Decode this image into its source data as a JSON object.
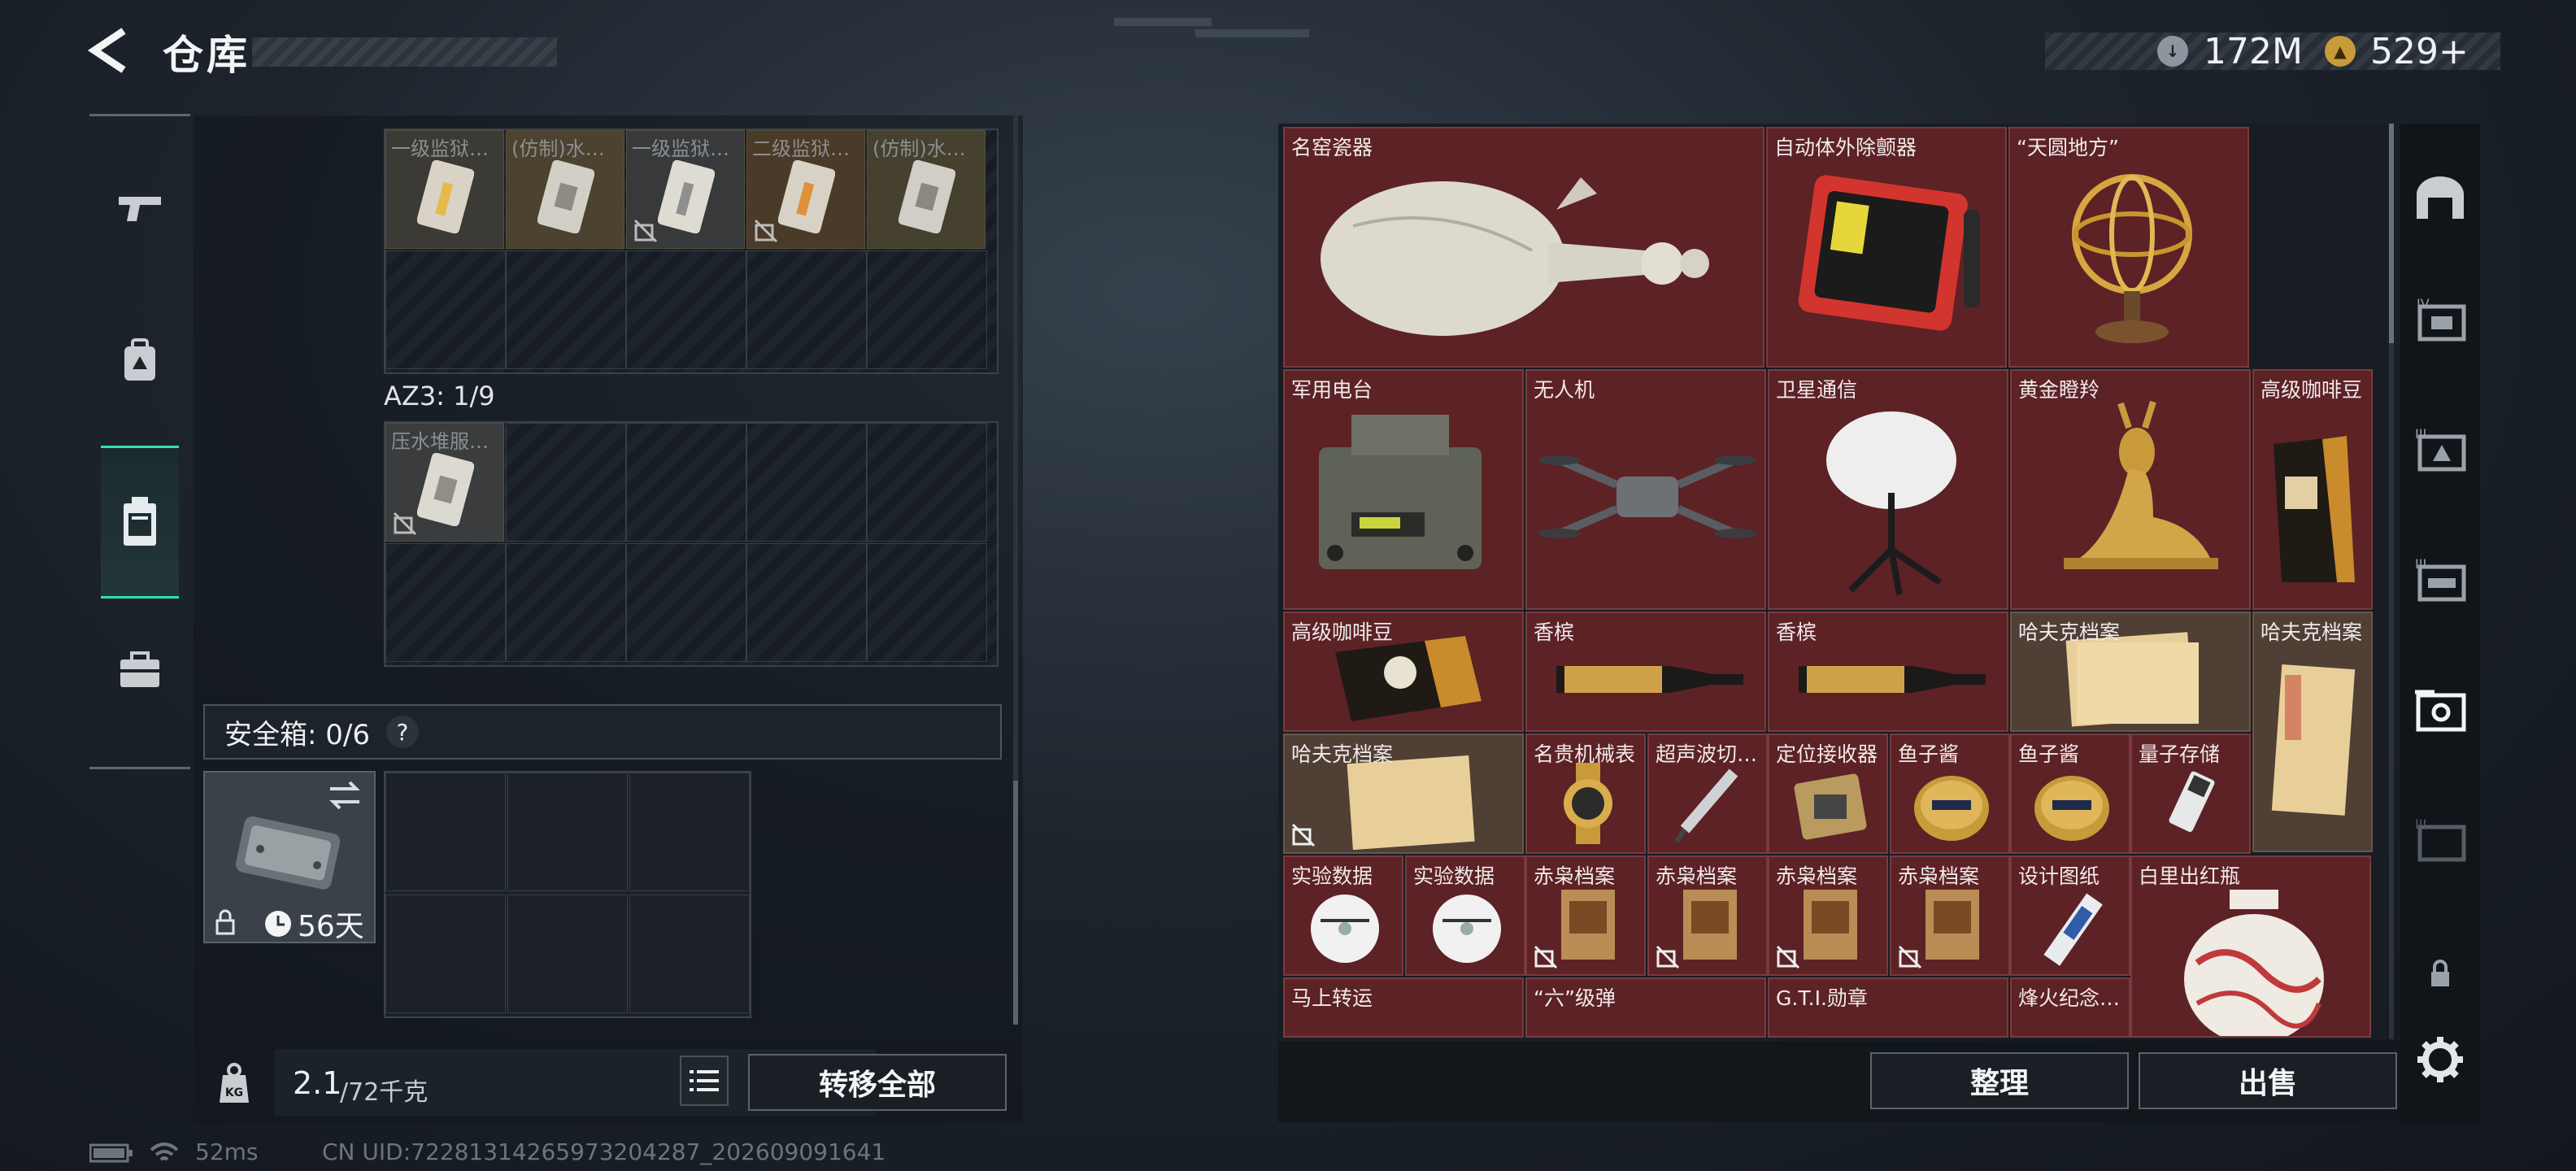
{
  "header": {
    "title": "仓库"
  },
  "currency": {
    "silver": "172M",
    "gold": "529+"
  },
  "sidebar": {
    "items": [
      "weapon-icon",
      "backpack-icon",
      "container-icon",
      "toolbox-icon"
    ],
    "active": 2
  },
  "left_panel": {
    "row1_items": [
      {
        "label": "一级监狱…",
        "tint": "#e3c460"
      },
      {
        "label": "(仿制)水…",
        "tint": "#b9b6ad"
      },
      {
        "label": "一级监狱…",
        "tint": "#cfcbbf"
      },
      {
        "label": "二级监狱…",
        "tint": "#e09b3c"
      },
      {
        "label": "(仿制)水…",
        "tint": "#bab8b0"
      }
    ],
    "section_label": "AZ3: 1/9",
    "row2_items": [
      {
        "label": "压水堆服…"
      }
    ],
    "safe_box": {
      "label": "安全箱: 0/6",
      "help": "?",
      "days": "56天"
    },
    "weight": {
      "current": "2.1",
      "max": "/72千克"
    },
    "transfer_all": "转移全部"
  },
  "items": [
    {
      "name": "名窑瓷器"
    },
    {
      "name": "自动体外除颤器"
    },
    {
      "name": "“天圆地方”"
    },
    {
      "name": "军用电台"
    },
    {
      "name": "无人机"
    },
    {
      "name": "卫星通信"
    },
    {
      "name": "黄金瞪羚"
    },
    {
      "name": "高级咖啡豆"
    },
    {
      "name": "高级咖啡豆"
    },
    {
      "name": "香槟"
    },
    {
      "name": "香槟"
    },
    {
      "name": "哈夫克档案"
    },
    {
      "name": "哈夫克档案"
    },
    {
      "name": "哈夫克档案"
    },
    {
      "name": "名贵机械表"
    },
    {
      "name": "超声波切…"
    },
    {
      "name": "定位接收器"
    },
    {
      "name": "鱼子酱"
    },
    {
      "name": "鱼子酱"
    },
    {
      "name": "量子存储"
    },
    {
      "name": "实验数据"
    },
    {
      "name": "实验数据"
    },
    {
      "name": "赤枭档案"
    },
    {
      "name": "赤枭档案"
    },
    {
      "name": "赤枭档案"
    },
    {
      "name": "赤枭档案"
    },
    {
      "name": "设计图纸"
    },
    {
      "name": "白里出红瓶"
    },
    {
      "name": "马上转运"
    },
    {
      "name": "“六”级弹"
    },
    {
      "name": "G.T.I.勋章"
    },
    {
      "name": "烽火纪念…"
    }
  ],
  "right_buttons": {
    "sort": "整理",
    "sell": "出售"
  },
  "status": {
    "ping": "52ms",
    "uid": "CN UID:7228131426597320428​7_202609091641"
  }
}
